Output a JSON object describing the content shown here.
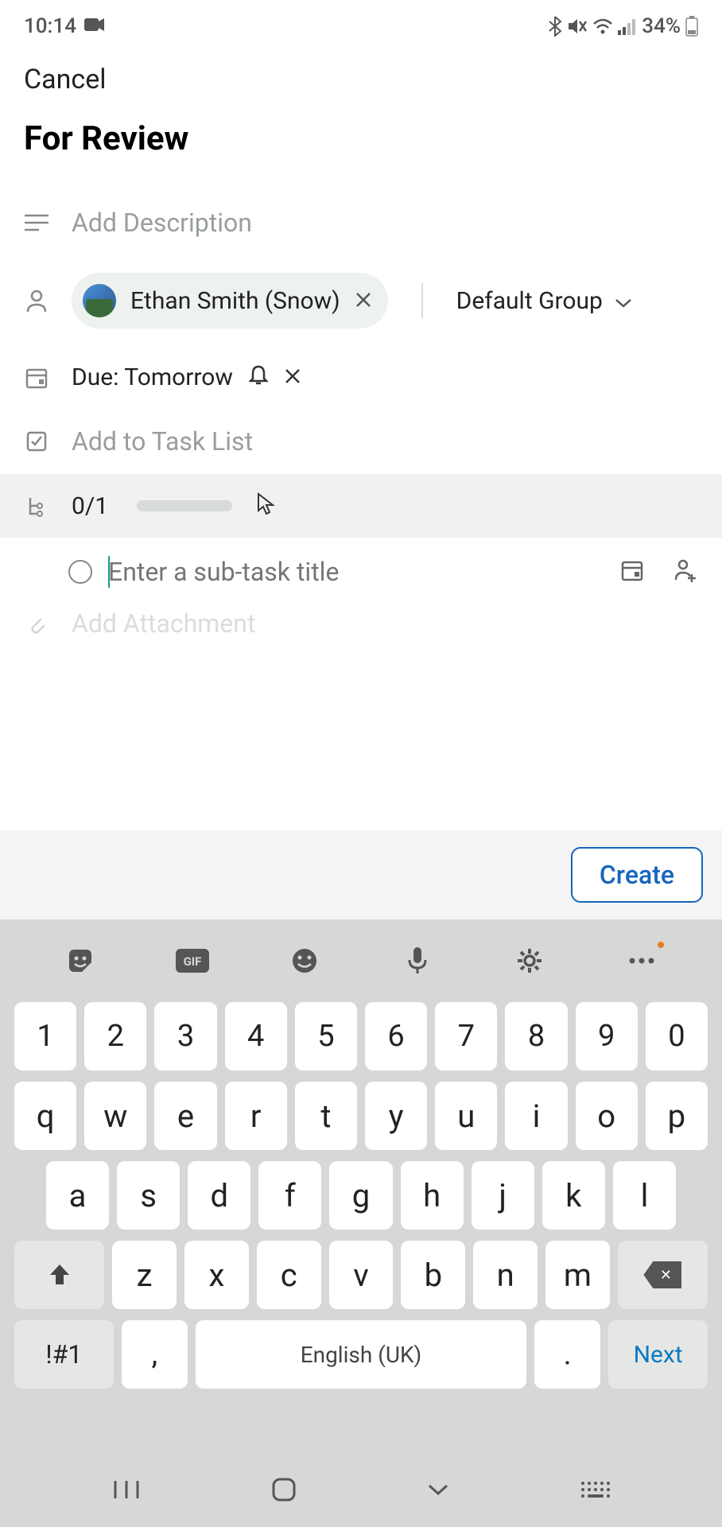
{
  "status": {
    "time": "10:14",
    "battery": "34%"
  },
  "header": {
    "cancel": "Cancel"
  },
  "title": "For Review",
  "description": {
    "placeholder": "Add Description"
  },
  "assignee": {
    "name": "Ethan Smith (Snow)"
  },
  "group": {
    "label": "Default Group"
  },
  "due": {
    "label": "Due: Tomorrow"
  },
  "tasklist": {
    "placeholder": "Add to Task List"
  },
  "subtask": {
    "count": "0/1",
    "placeholder": "Enter a sub-task title"
  },
  "attach": {
    "placeholder": "Add Attachment"
  },
  "create": {
    "label": "Create"
  },
  "keyboard": {
    "row_num": [
      "1",
      "2",
      "3",
      "4",
      "5",
      "6",
      "7",
      "8",
      "9",
      "0"
    ],
    "row1": [
      "q",
      "w",
      "e",
      "r",
      "t",
      "y",
      "u",
      "i",
      "o",
      "p"
    ],
    "row2": [
      "a",
      "s",
      "d",
      "f",
      "g",
      "h",
      "j",
      "k",
      "l"
    ],
    "row3": [
      "z",
      "x",
      "c",
      "v",
      "b",
      "n",
      "m"
    ],
    "sym": "!#1",
    "comma": ",",
    "space": "English (UK)",
    "period": ".",
    "next": "Next"
  }
}
